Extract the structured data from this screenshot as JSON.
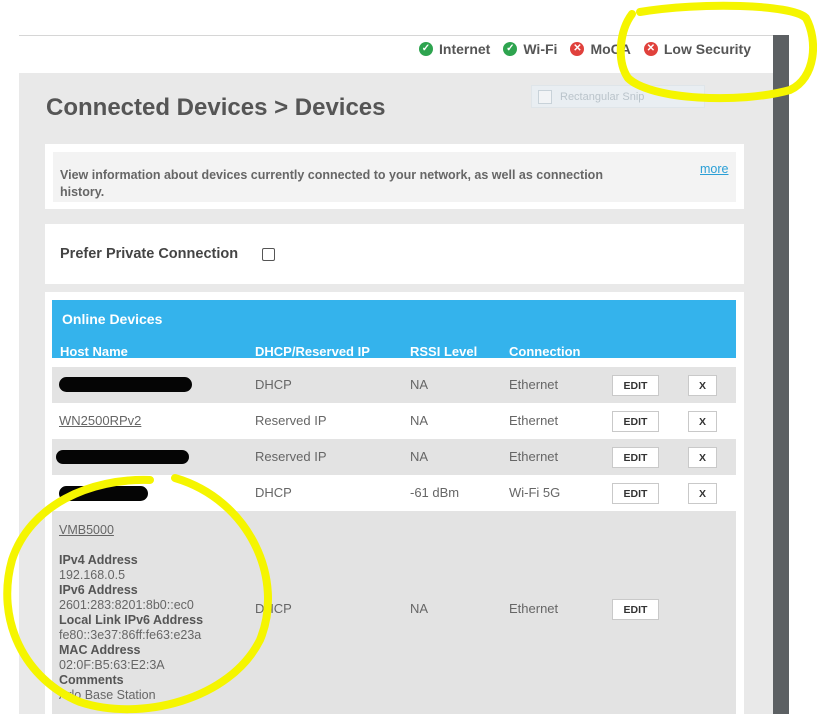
{
  "status": {
    "items": [
      {
        "label": "Internet",
        "state": "ok",
        "icon": "check-circle-icon",
        "color": "#2ea44f"
      },
      {
        "label": "Wi-Fi",
        "state": "ok",
        "icon": "check-circle-icon",
        "color": "#2ea44f"
      },
      {
        "label": "MoCA",
        "state": "error",
        "icon": "x-circle-icon",
        "color": "#e0413c"
      },
      {
        "label": "Low Security",
        "state": "error",
        "icon": "x-circle-icon",
        "color": "#e0413c"
      }
    ]
  },
  "page": {
    "title": "Connected Devices > Devices"
  },
  "snip": {
    "label": "Rectangular Snip"
  },
  "info": {
    "text": "View information about devices currently connected to your network, as well as connection history.",
    "more_label": "more"
  },
  "preferences": {
    "private_connection_label": "Prefer Private Connection",
    "private_connection_checked": false
  },
  "online_devices": {
    "title": "Online Devices",
    "columns": [
      "Host Name",
      "DHCP/Reserved IP",
      "RSSI Level",
      "Connection"
    ],
    "edit_label": "EDIT",
    "delete_label": "X",
    "rows": [
      {
        "host": "",
        "host_redacted": true,
        "ip_type": "DHCP",
        "rssi": "NA",
        "connection": "Ethernet"
      },
      {
        "host": "WN2500RPv2",
        "host_redacted": false,
        "ip_type": "Reserved IP",
        "rssi": "NA",
        "connection": "Ethernet"
      },
      {
        "host": "",
        "host_redacted": true,
        "ip_type": "Reserved IP",
        "rssi": "NA",
        "connection": "Ethernet"
      },
      {
        "host": "",
        "host_redacted": true,
        "ip_type": "DHCP",
        "rssi": "-61 dBm",
        "connection": "Wi-Fi 5G"
      },
      {
        "host": "VMB5000",
        "host_redacted": false,
        "ip_type": "DHCP",
        "rssi": "NA",
        "connection": "Ethernet",
        "details": {
          "ipv4_label": "IPv4 Address",
          "ipv4": "192.168.0.5",
          "ipv6_label": "IPv6 Address",
          "ipv6": "2601:283:8201:8b0::ec0",
          "link_local_label": "Local Link IPv6 Address",
          "link_local": "fe80::3e37:86ff:fe63:e23a",
          "mac_label": "MAC Address",
          "mac": "02:0F:B5:63:E2:3A",
          "comments_label": "Comments",
          "comments": "Arlo Base Station"
        }
      }
    ]
  },
  "colors": {
    "accent": "#34b3ec",
    "highlight": "#f5f500",
    "link": "#2a9fd6"
  }
}
